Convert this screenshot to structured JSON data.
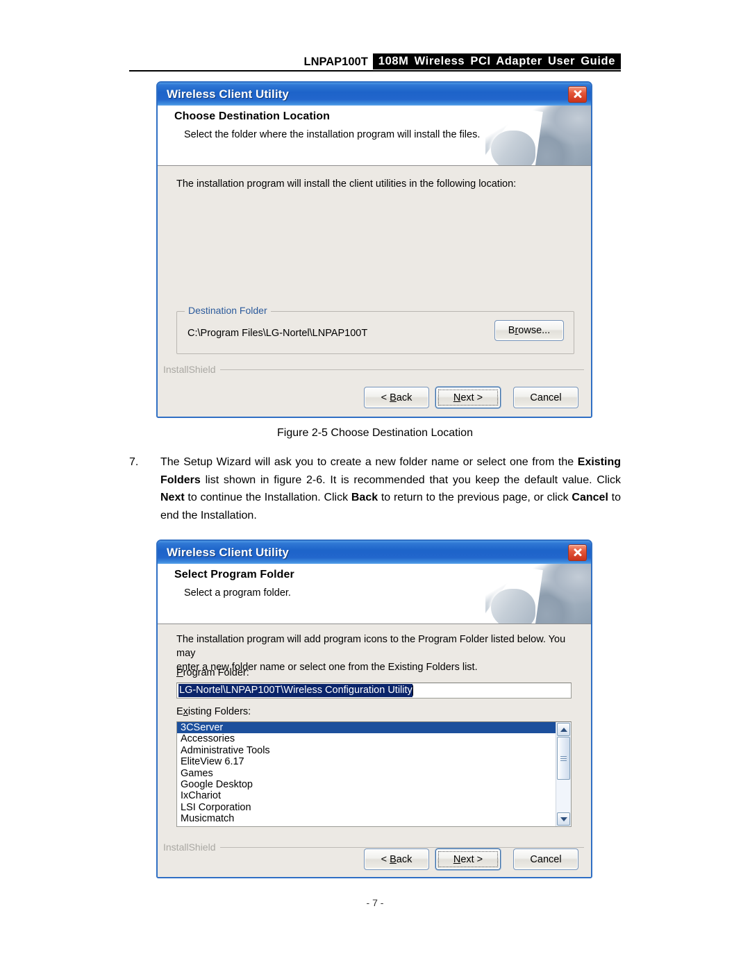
{
  "header": {
    "model": "LNPAP100T",
    "title": "108M Wireless PCI Adapter User Guide"
  },
  "dialog1": {
    "titlebar": "Wireless Client Utility",
    "close_icon": "close-icon",
    "banner_title": "Choose Destination Location",
    "banner_subtitle": "Select the folder where the installation program will install the files.",
    "body_text": "The installation program will install the client utilities in the following location:",
    "group_legend": "Destination Folder",
    "path_value": "C:\\Program Files\\LG-Nortel\\LNPAP100T",
    "browse_label_pre": "B",
    "browse_label_acc": "r",
    "browse_label_post": "owse...",
    "installshield": "InstallShield",
    "buttons": {
      "back_pre": "< ",
      "back_acc": "B",
      "back_post": "ack",
      "next_acc": "N",
      "next_post": "ext >",
      "cancel": "Cancel"
    }
  },
  "figure1": {
    "caption": "Figure 2-5   Choose Destination Location"
  },
  "step7": {
    "number": "7.",
    "t1": "The Setup Wizard will ask you to create a new folder name or select one from the ",
    "b1": "Existing Folders",
    "t2": " list shown in figure 2-6. It is recommended that you keep the default value. Click ",
    "b2": "Next",
    "t3": " to continue the Installation. Click ",
    "b3": "Back",
    "t4": " to return to the previous page, or click ",
    "b4": "Cancel",
    "t5": " to end the Installation."
  },
  "dialog2": {
    "titlebar": "Wireless Client Utility",
    "close_icon": "close-icon",
    "banner_title": "Select Program Folder",
    "banner_subtitle": "Select a program folder.",
    "body_text_line1": "The installation program will add program icons to the Program Folder listed below. You may",
    "body_text_line2_pre": "enter a new folder name or select one from the Existin",
    "body_text_line2_acc": "g",
    "body_text_line2_post": " Folders list.",
    "program_folder_label_acc": "P",
    "program_folder_label_post": "rogram Folder:",
    "program_folder_value": "LG-Nortel\\LNPAP100T\\Wireless Configuration Utility",
    "existing_folders_label_pre": "E",
    "existing_folders_label_acc": "x",
    "existing_folders_label_post": "isting Folders:",
    "existing_folders": [
      "3CServer",
      "Accessories",
      "Administrative Tools",
      "EliteView 6.17",
      "Games",
      "Google Desktop",
      "IxChariot",
      "LSI Corporation",
      "Musicmatch"
    ],
    "selected_folder_index": 0,
    "installshield": "InstallShield",
    "buttons": {
      "back_pre": "< ",
      "back_acc": "B",
      "back_post": "ack",
      "next_acc": "N",
      "next_post": "ext >",
      "cancel": "Cancel"
    }
  },
  "footer": {
    "page_number": "- 7 -"
  }
}
